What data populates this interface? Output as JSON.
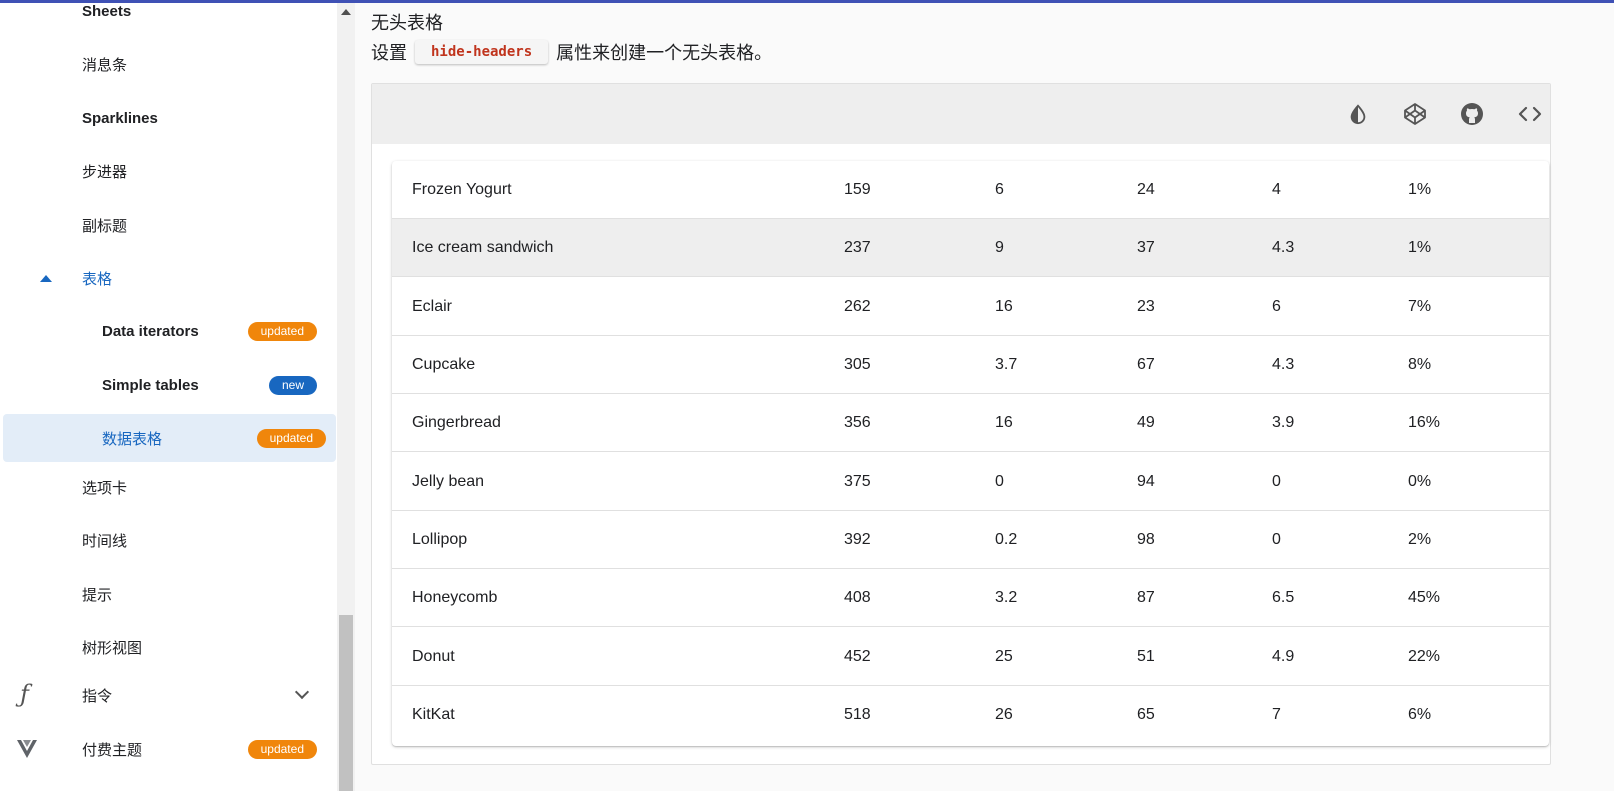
{
  "sidebar": {
    "items": [
      {
        "label": "Sheets"
      },
      {
        "label": "消息条"
      },
      {
        "label": "Sparklines"
      },
      {
        "label": "步进器"
      },
      {
        "label": "副标题"
      },
      {
        "label": "表格"
      },
      {
        "label": "Data iterators",
        "badge": "updated"
      },
      {
        "label": "Simple tables",
        "badge": "new"
      },
      {
        "label": "数据表格",
        "badge": "updated"
      },
      {
        "label": "选项卡"
      },
      {
        "label": "时间线"
      },
      {
        "label": "提示"
      },
      {
        "label": "树形视图"
      },
      {
        "label": "指令",
        "icon": "function-icon"
      },
      {
        "label": "付费主题",
        "icon": "vuetify-logo-icon",
        "badge": "updated"
      }
    ]
  },
  "main": {
    "title": "无头表格",
    "desc_prefix": "设置",
    "desc_code": "hide-headers",
    "desc_suffix": "属性来创建一个无头表格。",
    "toolbar_icons": [
      "invert-colors-icon",
      "codepen-icon",
      "github-icon",
      "code-tags-icon"
    ]
  },
  "table": {
    "rows": [
      [
        "Frozen Yogurt",
        "159",
        "6",
        "24",
        "4",
        "1%"
      ],
      [
        "Ice cream sandwich",
        "237",
        "9",
        "37",
        "4.3",
        "1%"
      ],
      [
        "Eclair",
        "262",
        "16",
        "23",
        "6",
        "7%"
      ],
      [
        "Cupcake",
        "305",
        "3.7",
        "67",
        "4.3",
        "8%"
      ],
      [
        "Gingerbread",
        "356",
        "16",
        "49",
        "3.9",
        "16%"
      ],
      [
        "Jelly bean",
        "375",
        "0",
        "94",
        "0",
        "0%"
      ],
      [
        "Lollipop",
        "392",
        "0.2",
        "98",
        "0",
        "2%"
      ],
      [
        "Honeycomb",
        "408",
        "3.2",
        "87",
        "6.5",
        "45%"
      ],
      [
        "Donut",
        "452",
        "25",
        "51",
        "4.9",
        "22%"
      ],
      [
        "KitKat",
        "518",
        "26",
        "65",
        "7",
        "6%"
      ]
    ]
  },
  "colors": {
    "accent": "#1867c0",
    "badge_updated": "#f0860b",
    "badge_new": "#1867c0",
    "code_text": "#c0341d"
  }
}
